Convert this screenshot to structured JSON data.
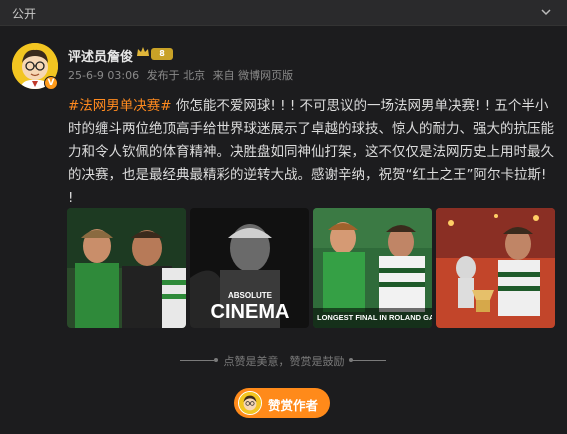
{
  "header": {
    "visibility": "公开",
    "chevron_icon": "chevron-down-icon"
  },
  "author": {
    "name": "评述员詹俊",
    "verified_badge": "V",
    "level_badge": "8",
    "crown_icon": "crown-icon"
  },
  "meta": {
    "time": "25-6-9 03:06",
    "location": "发布于 北京",
    "source": "来自 微博网页版"
  },
  "post": {
    "hashtag": "#法网男单决赛#",
    "body": " 你怎能不爱网球! ! ! 不可思议的一场法网男单决赛! ! 五个半小时的缠斗两位绝顶高手给世界球迷展示了卓越的球技、惊人的耐力、强大的抗压能力和令人钦佩的体育精神。决胜盘如同神仙打架，这不仅仅是法网历史上用时最久的决赛，也是最经典最精彩的逆转大战。感谢辛纳，祝贺“红土之王”阿尔卡拉斯! !"
  },
  "images": [
    {
      "alt": "two players close-up",
      "overlay": ""
    },
    {
      "alt": "black and white portrait",
      "overlay_top": "ABSOLUTE",
      "overlay_main": "CINEMA"
    },
    {
      "alt": "two players at the net",
      "overlay": "LONGEST FINAL IN ROLAND GARROS HISTORY"
    },
    {
      "alt": "celebration with trophy",
      "overlay": ""
    }
  ],
  "reward": {
    "slogan": "点赞是美意，赞赏是鼓励",
    "button_label": "赞赏作者"
  },
  "colors": {
    "accent": "#ff8a1f",
    "background": "#1c1c1e",
    "reward_button": "#ff8a1a"
  }
}
